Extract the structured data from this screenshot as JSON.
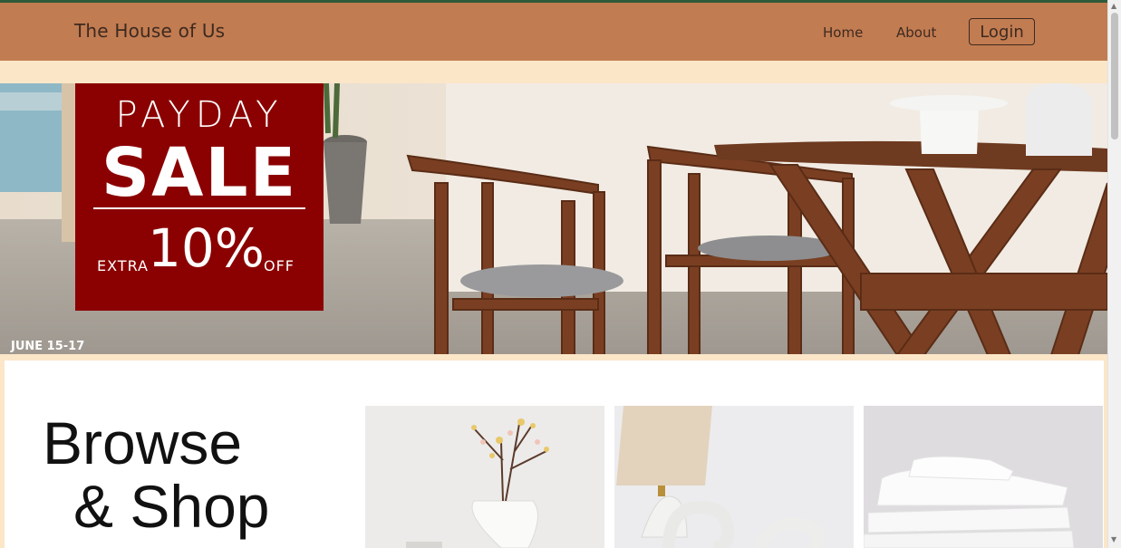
{
  "header": {
    "brand": "The House of Us",
    "nav": {
      "home": "Home",
      "about": "About",
      "login": "Login"
    }
  },
  "hero": {
    "headline_top": "PAYDAY",
    "headline_main": "SALE",
    "extra": "EXTRA",
    "discount": "10%",
    "off": "OFF",
    "date": "JUNE 15-17"
  },
  "browse": {
    "title_line1": "Browse",
    "title_line2": "& Shop",
    "cards": [
      {
        "icon": "vase-branch-image"
      },
      {
        "icon": "lamp-sculpture-image"
      },
      {
        "icon": "folded-linens-image"
      }
    ]
  },
  "colors": {
    "navbar": "#c27c51",
    "background": "#fbe6c8",
    "sale_box": "#8b0000"
  }
}
